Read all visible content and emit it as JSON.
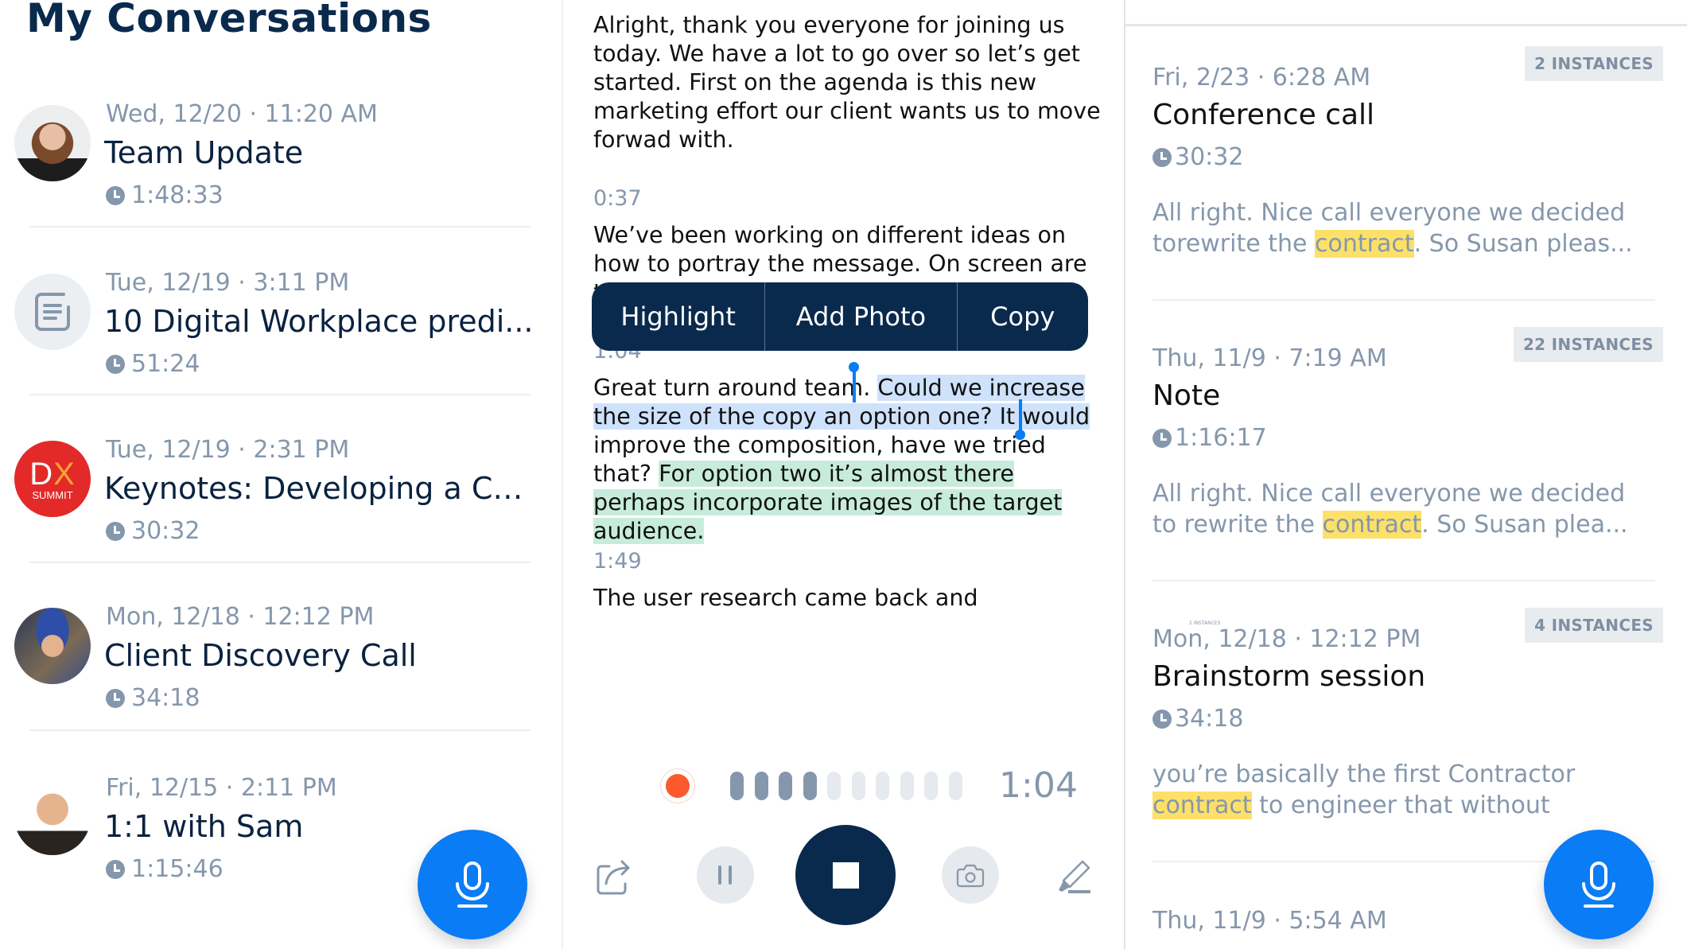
{
  "left": {
    "title": "My Conversations",
    "conversations": [
      {
        "date": "Wed, 12/20 · 11:20 AM",
        "title": "Team Update",
        "duration": "1:48:33",
        "avatar": "person-photo"
      },
      {
        "date": "Tue, 12/19 · 3:11 PM",
        "title": "10 Digital Workplace predi...",
        "duration": "51:24",
        "avatar": "document-icon"
      },
      {
        "date": "Tue, 12/19 · 2:31 PM",
        "title": "Keynotes: Developing a Cu...",
        "duration": "30:32",
        "avatar": "dx-summit-logo",
        "logo_text": {
          "main": "D",
          "accent": "X",
          "sub": "SUMMIT"
        }
      },
      {
        "date": "Mon, 12/18 · 12:12 PM",
        "title": "Client Discovery Call",
        "duration": "34:18",
        "avatar": "person-photo"
      },
      {
        "date": "Fri, 12/15 · 2:11 PM",
        "title": "1:1 with Sam",
        "duration": "1:15:46",
        "avatar": "person-photo"
      }
    ],
    "fab_icon": "microphone-icon"
  },
  "middle": {
    "paragraphs": [
      {
        "timestamp": "",
        "text": "Alright, thank you everyone for joining us today. We have a lot to go over so let’s get started. First on the agenda is this new marketing effort our client wants us to move forwad with."
      },
      {
        "timestamp": "0:37",
        "text": "We’ve been working on different ideas on how to portray the message. On screen are two"
      },
      {
        "timestamp": "1:04",
        "segments": {
          "plain_before": "Great turn around team.",
          "selected": "Could we increase the size of the copy an option one? It would",
          "plain_after": "improve the composition, have we tried that?",
          "highlighted": "For option two it’s almost there perhaps incorporate images of the target audience."
        }
      },
      {
        "timestamp": "1:49",
        "text": "The user research came back and"
      }
    ],
    "context_menu": [
      "Highlight",
      "Add Photo",
      "Copy"
    ],
    "recorder": {
      "status": "recording",
      "elapsed": "1:04",
      "level_bars_total": 10,
      "level_bars_active": 4,
      "colors": {
        "record": "#fa5a2c",
        "active_bar": "#8597ac",
        "inactive_bar": "#e6e9ed",
        "stop": "#0a2a4d"
      }
    },
    "controls": [
      "share-icon",
      "pause-icon",
      "stop-icon",
      "camera-icon",
      "highlighter-icon"
    ]
  },
  "right": {
    "results": [
      {
        "date": "Fri, 2/23 · 6:28 AM",
        "title": "Conference call",
        "duration": "30:32",
        "badge": "2 INSTANCES",
        "snippet": {
          "before": "All right. Nice call everyone we decided torewrite the ",
          "keyword": "contract",
          "after": ". So Susan pleas..."
        }
      },
      {
        "date": "Thu, 11/9 · 7:19 AM",
        "title": "Note",
        "duration": "1:16:17",
        "badge": "22 INSTANCES",
        "snippet": {
          "before": "All right. Nice call everyone we decided to rewrite the ",
          "keyword": "contract",
          "after": ". So Susan plea..."
        }
      },
      {
        "date": "Mon, 12/18 · 12:12 PM",
        "title": "Brainstorm session",
        "duration": "34:18",
        "badge": "4 INSTANCES",
        "ghost_label": "2 INSTANCES",
        "snippet": {
          "before": "you’re basically the first Contractor ",
          "keyword": "contract",
          "after": " to engineer that without"
        }
      },
      {
        "date": "Thu, 11/9 · 5:54 AM"
      }
    ],
    "highlight_color": "#fde068",
    "fab_icon": "microphone-icon"
  }
}
